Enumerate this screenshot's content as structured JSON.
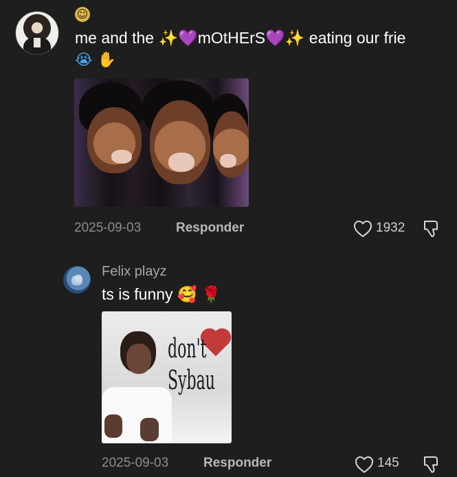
{
  "comment": {
    "status_emoji_icon": "slightly-smiling-face-icon",
    "text": "me and the ✨💜mOtHErS💜✨ eating our frie",
    "emoji_line": [
      {
        "icon": "loudly-crying-face-icon",
        "glyph": "😭"
      },
      {
        "icon": "raised-hand-icon",
        "glyph": "✋"
      }
    ],
    "date": "2025-09-03",
    "reply_label": "Responder",
    "likes": "1932"
  },
  "reply": {
    "author": "Felix playz",
    "text": "ts is funny",
    "emojis": [
      {
        "icon": "smiling-face-with-hearts-icon",
        "glyph": "🥰"
      },
      {
        "icon": "rose-icon",
        "glyph": "🌹"
      }
    ],
    "meme_text": "don't Sybau",
    "date": "2025-09-03",
    "reply_label": "Responder",
    "likes": "145"
  },
  "colors": {
    "background": "#1e1e1e",
    "primary_text": "#ffffff",
    "secondary_text": "#8d8d8d",
    "action_text": "#b8b8b8",
    "icon_color": "#d8d8d8"
  }
}
